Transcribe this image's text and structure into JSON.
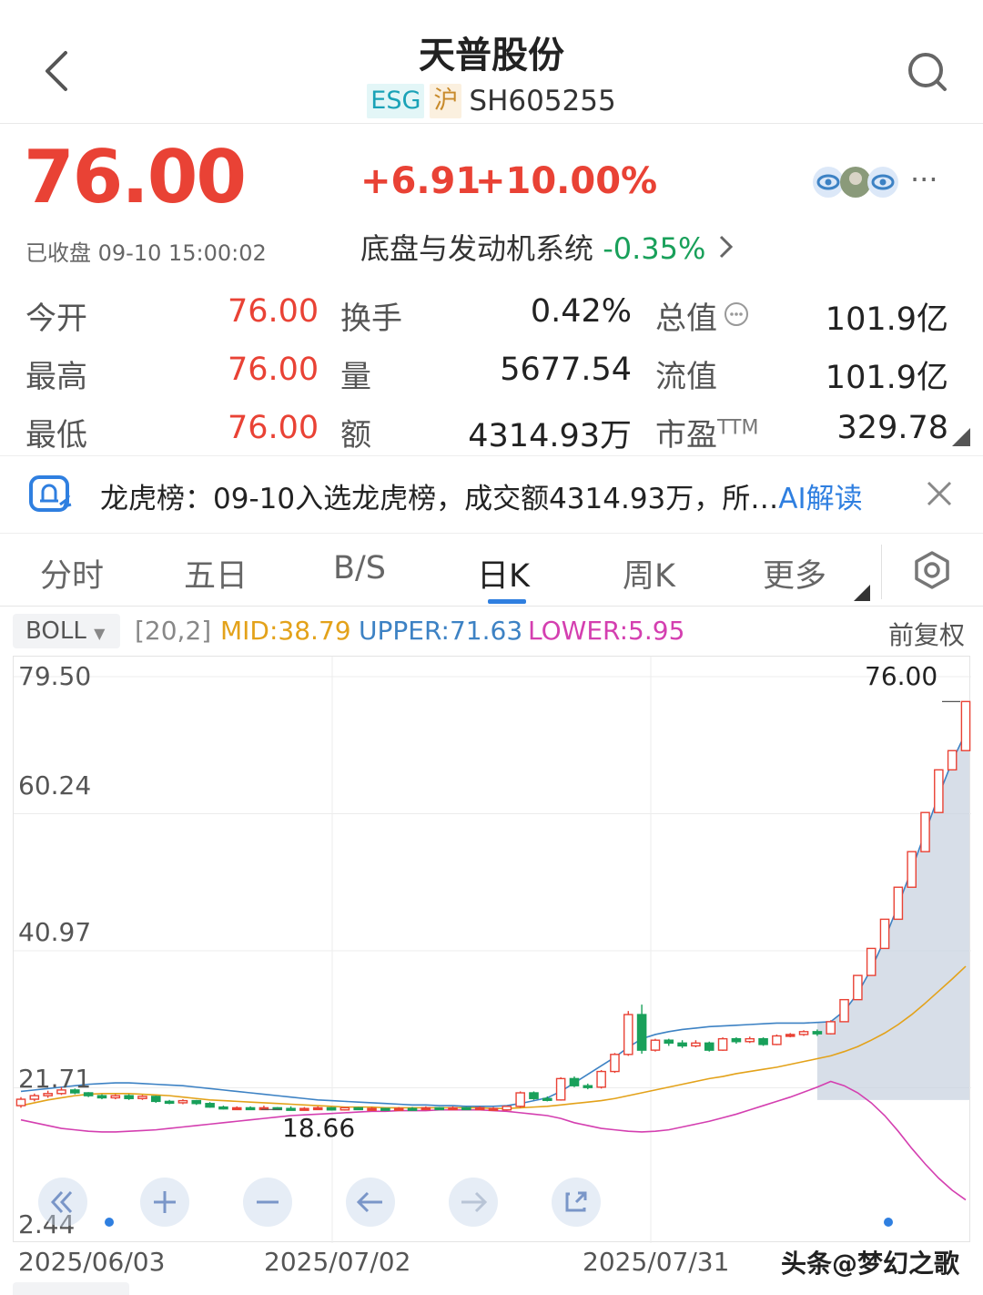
{
  "header": {
    "title": "天普股份",
    "tag_esg": "ESG",
    "tag_market": "沪",
    "code": "SH605255"
  },
  "quote": {
    "price": "76.00",
    "change": "+6.91",
    "change_pct": "+10.00%",
    "status": "已收盘 09-10 15:00:02",
    "sector_name": "底盘与发动机系统",
    "sector_change": "-0.35%",
    "more": "···"
  },
  "stats": {
    "open_label": "今开",
    "open": "76.00",
    "high_label": "最高",
    "high": "76.00",
    "low_label": "最低",
    "low": "76.00",
    "turnover_label": "换手",
    "turnover": "0.42%",
    "volume_label": "量",
    "volume": "5677.54",
    "amount_label": "额",
    "amount": "4314.93万",
    "mktcap_label": "总值",
    "mktcap": "101.9亿",
    "float_label": "流值",
    "float": "101.9亿",
    "pe_label": "市盈",
    "pe_sup": "TTM",
    "pe": "329.78"
  },
  "banner": {
    "text": "龙虎榜：09-10入选龙虎榜，成交额4314.93万，所…",
    "ai": "AI解读"
  },
  "tabs": [
    "分时",
    "五日",
    "B/S",
    "日K",
    "周K",
    "更多"
  ],
  "active_tab": "日K",
  "indicator": {
    "name": "BOLL",
    "params": "[20,2]",
    "mid": "MID:38.79",
    "upper": "UPPER:71.63",
    "lower": "LOWER:5.95",
    "adjust": "前复权"
  },
  "chart_data": {
    "type": "candlestick",
    "y_ticks": [
      "79.50",
      "60.24",
      "40.97",
      "21.71",
      "2.44"
    ],
    "ylim": [
      2.44,
      79.5
    ],
    "x_ticks": [
      "2025/06/03",
      "2025/07/02",
      "2025/07/31"
    ],
    "max_label": "76.00",
    "min_label": "18.66",
    "colors": {
      "up": "#e94235",
      "down": "#19a05a",
      "mid": "#e3a21a",
      "upper": "#3d82c4",
      "lower": "#d43fb0",
      "flat_up": "#e94235"
    },
    "candles": [
      [
        19.2,
        20.1,
        18.9,
        20.4
      ],
      [
        20.1,
        20.6,
        19.8,
        20.9
      ],
      [
        20.6,
        20.9,
        20.3,
        21.3
      ],
      [
        20.9,
        21.4,
        20.7,
        21.8
      ],
      [
        21.4,
        21.0,
        20.8,
        21.6
      ],
      [
        21.0,
        20.6,
        20.4,
        21.1
      ],
      [
        20.6,
        20.3,
        20.1,
        20.8
      ],
      [
        20.3,
        20.6,
        20.1,
        20.8
      ],
      [
        20.6,
        20.2,
        20.0,
        20.8
      ],
      [
        20.2,
        20.5,
        20.0,
        20.7
      ],
      [
        20.5,
        19.8,
        19.6,
        20.6
      ],
      [
        19.8,
        19.6,
        19.4,
        20.0
      ],
      [
        19.6,
        19.9,
        19.4,
        20.1
      ],
      [
        19.9,
        19.5,
        19.3,
        20.0
      ],
      [
        19.5,
        19.0,
        18.9,
        19.7
      ],
      [
        19.0,
        18.8,
        18.66,
        19.2
      ],
      [
        18.8,
        18.9,
        18.7,
        19.1
      ],
      [
        18.9,
        18.8,
        18.7,
        19.1
      ],
      [
        18.8,
        18.9,
        18.7,
        19.2
      ],
      [
        18.9,
        18.8,
        18.66,
        19.0
      ],
      [
        18.8,
        18.6,
        18.5,
        19.1
      ],
      [
        18.6,
        18.8,
        18.5,
        19.0
      ],
      [
        18.8,
        18.9,
        18.7,
        19.1
      ],
      [
        18.9,
        18.6,
        18.5,
        19.0
      ],
      [
        18.6,
        18.9,
        18.5,
        19.0
      ],
      [
        18.9,
        18.7,
        18.6,
        19.0
      ],
      [
        18.7,
        18.8,
        18.6,
        19.0
      ],
      [
        18.8,
        18.6,
        18.5,
        18.9
      ],
      [
        18.6,
        18.8,
        18.5,
        19.0
      ],
      [
        18.8,
        18.7,
        18.6,
        19.0
      ],
      [
        18.7,
        18.9,
        18.6,
        19.1
      ],
      [
        18.9,
        18.8,
        18.7,
        19.0
      ],
      [
        18.8,
        18.9,
        18.7,
        19.1
      ],
      [
        18.9,
        18.8,
        18.7,
        19.0
      ],
      [
        18.8,
        18.9,
        18.7,
        19.1
      ],
      [
        18.6,
        18.8,
        18.6,
        19.0
      ],
      [
        18.6,
        19.1,
        18.5,
        19.2
      ],
      [
        19.1,
        21.0,
        18.9,
        21.2
      ],
      [
        21.0,
        20.2,
        20.0,
        21.2
      ],
      [
        20.2,
        20.0,
        19.8,
        20.5
      ],
      [
        20.0,
        23.0,
        19.9,
        23.2
      ],
      [
        23.0,
        22.0,
        21.8,
        23.3
      ],
      [
        22.0,
        21.8,
        21.5,
        22.3
      ],
      [
        21.8,
        24.0,
        21.6,
        24.2
      ],
      [
        24.0,
        26.4,
        23.8,
        26.6
      ],
      [
        26.4,
        32.0,
        26.2,
        32.5
      ],
      [
        32.0,
        27.0,
        26.5,
        33.4
      ],
      [
        27.0,
        28.4,
        26.8,
        28.6
      ],
      [
        28.4,
        28.0,
        27.6,
        28.6
      ],
      [
        28.0,
        27.6,
        27.3,
        28.4
      ],
      [
        27.6,
        28.0,
        27.4,
        28.4
      ],
      [
        28.0,
        27.0,
        26.8,
        28.2
      ],
      [
        27.0,
        28.6,
        26.9,
        28.8
      ],
      [
        28.6,
        28.2,
        27.9,
        28.8
      ],
      [
        28.2,
        28.6,
        28.0,
        28.9
      ],
      [
        28.6,
        27.8,
        27.6,
        28.8
      ],
      [
        27.8,
        29.0,
        27.7,
        29.2
      ],
      [
        29.0,
        29.2,
        28.8,
        29.4
      ],
      [
        29.2,
        29.6,
        29.0,
        29.8
      ],
      [
        29.6,
        29.3,
        29.0,
        29.9
      ],
      [
        29.3,
        31.0,
        29.2,
        31.2
      ],
      [
        31.0,
        34.1,
        31.0,
        34.1
      ],
      [
        34.1,
        37.5,
        34.1,
        37.5
      ],
      [
        37.5,
        41.3,
        37.5,
        41.3
      ],
      [
        41.3,
        45.4,
        41.3,
        45.4
      ],
      [
        45.4,
        49.9,
        45.4,
        49.9
      ],
      [
        49.9,
        54.9,
        49.9,
        54.9
      ],
      [
        54.9,
        60.4,
        54.9,
        60.4
      ],
      [
        60.4,
        66.4,
        60.4,
        66.4
      ],
      [
        66.4,
        69.1,
        66.4,
        69.1
      ],
      [
        69.1,
        76.0,
        69.1,
        76.0
      ]
    ],
    "mid_line": [
      19.2,
      19.6,
      20.0,
      20.3,
      20.6,
      20.8,
      20.9,
      20.9,
      20.9,
      20.8,
      20.7,
      20.6,
      20.4,
      20.2,
      20.0,
      19.9,
      19.8,
      19.7,
      19.6,
      19.5,
      19.4,
      19.3,
      19.2,
      19.1,
      19.0,
      19.0,
      19.0,
      18.9,
      18.9,
      18.9,
      18.9,
      18.9,
      18.9,
      18.9,
      18.9,
      18.8,
      18.8,
      18.9,
      19.0,
      19.1,
      19.3,
      19.5,
      19.7,
      19.9,
      20.2,
      20.6,
      21.0,
      21.4,
      21.8,
      22.2,
      22.6,
      23.0,
      23.3,
      23.7,
      24.0,
      24.3,
      24.6,
      25.0,
      25.4,
      25.8,
      26.2,
      26.8,
      27.5,
      28.4,
      29.4,
      30.6,
      32.0,
      33.6,
      35.3,
      37.0,
      38.79
    ],
    "upper_line": [
      21.2,
      21.4,
      21.6,
      21.8,
      22.0,
      22.2,
      22.3,
      22.4,
      22.4,
      22.3,
      22.2,
      22.1,
      22.0,
      21.8,
      21.6,
      21.4,
      21.2,
      21.0,
      20.8,
      20.6,
      20.4,
      20.2,
      20.0,
      19.9,
      19.8,
      19.7,
      19.6,
      19.5,
      19.4,
      19.3,
      19.3,
      19.2,
      19.2,
      19.1,
      19.1,
      19.1,
      19.2,
      19.5,
      19.9,
      20.3,
      21.2,
      22.4,
      23.6,
      24.8,
      26.0,
      27.4,
      28.6,
      29.2,
      29.6,
      29.9,
      30.1,
      30.3,
      30.4,
      30.5,
      30.6,
      30.7,
      30.8,
      30.8,
      30.8,
      30.9,
      31.0,
      32.5,
      35.0,
      38.4,
      42.6,
      47.4,
      52.4,
      57.6,
      62.8,
      67.6,
      71.63
    ],
    "lower_line": [
      17.2,
      16.8,
      16.4,
      16.0,
      15.8,
      15.6,
      15.5,
      15.5,
      15.6,
      15.7,
      15.8,
      16.0,
      16.2,
      16.4,
      16.6,
      16.8,
      17.0,
      17.2,
      17.4,
      17.6,
      17.8,
      17.9,
      18.0,
      18.1,
      18.2,
      18.3,
      18.4,
      18.4,
      18.5,
      18.5,
      18.5,
      18.6,
      18.6,
      18.6,
      18.6,
      18.5,
      18.4,
      18.2,
      18.0,
      17.8,
      17.4,
      16.8,
      16.4,
      16.0,
      15.8,
      15.6,
      15.5,
      15.6,
      15.8,
      16.2,
      16.6,
      17.0,
      17.5,
      18.0,
      18.6,
      19.2,
      19.8,
      20.4,
      21.1,
      21.8,
      22.6,
      22.0,
      21.0,
      19.6,
      17.8,
      15.6,
      13.2,
      11.0,
      9.0,
      7.3,
      5.95
    ]
  },
  "watermark": "头条@梦幻之歌"
}
